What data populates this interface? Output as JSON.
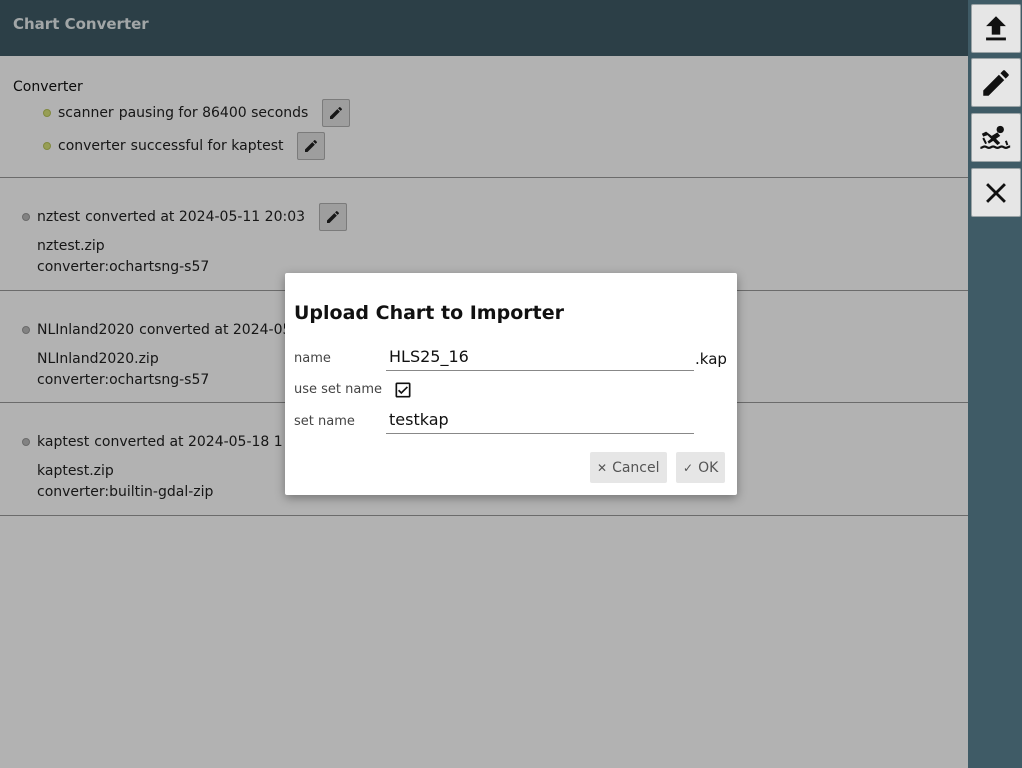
{
  "app": {
    "title": "Chart Converter"
  },
  "toolbar": {
    "buttons": [
      {
        "name": "upload",
        "icon": "upload-icon"
      },
      {
        "name": "edit",
        "icon": "pencil-icon"
      },
      {
        "name": "ocharts",
        "icon": "swimmer-icon"
      },
      {
        "name": "close",
        "icon": "close-icon"
      }
    ]
  },
  "converter": {
    "title": "Converter",
    "status": [
      {
        "name": "scanner",
        "text": "pausing for 86400 seconds"
      },
      {
        "name": "converter",
        "text": "successful for kaptest"
      }
    ]
  },
  "charts": [
    {
      "name": "nztest",
      "info": "converted at 2024-05-11 20:03",
      "file": "nztest.zip",
      "converter": "converter:ochartsng-s57"
    },
    {
      "name": "NLInland2020",
      "info": "converted at 2024-05",
      "file": "NLInland2020.zip",
      "converter": "converter:ochartsng-s57"
    },
    {
      "name": "kaptest",
      "info": "converted at 2024-05-18 1",
      "file": "kaptest.zip",
      "converter": "converter:builtin-gdal-zip"
    }
  ],
  "dialog": {
    "title": "Upload Chart to Importer",
    "name_label": "name",
    "name_value": "HLS25_16",
    "name_suffix": ".kap",
    "use_set_label": "use set name",
    "use_set_checked": true,
    "set_label": "set name",
    "set_value": "testkap",
    "cancel_label": "Cancel",
    "ok_label": "OK"
  },
  "colors": {
    "header": "#3f5b66",
    "status_ok": "#d8e27a",
    "status_idle": "#bbbbbb"
  }
}
